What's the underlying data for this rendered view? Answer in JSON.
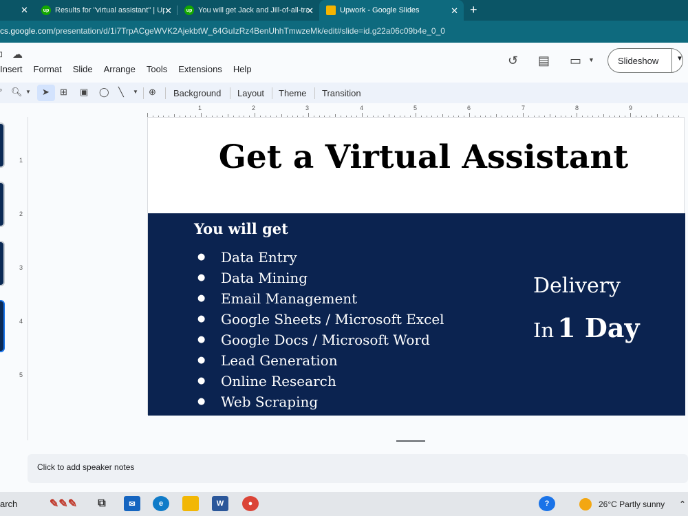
{
  "browser": {
    "tabs": [
      {
        "title": "Results for \"virtual assistant\" | Up",
        "favicon": "up"
      },
      {
        "title": "You will get Jack and Jill-of-all-tra",
        "favicon": "up"
      },
      {
        "title": "Upwork - Google Slides",
        "favicon": "slides",
        "active": true
      }
    ],
    "url_host": "cs.google.com",
    "url_path": "/presentation/d/1i7TrpACgeWVK2AjekbtW_64GuIzRz4BenUhhTmwzeMk/edit#slide=id.g22a06c09b4e_0_0"
  },
  "menu": [
    "Insert",
    "Format",
    "Slide",
    "Arrange",
    "Tools",
    "Extensions",
    "Help"
  ],
  "header": {
    "slideshow_label": "Slideshow"
  },
  "toolbar": {
    "background": "Background",
    "layout": "Layout",
    "theme": "Theme",
    "transition": "Transition"
  },
  "ruler_numbers": [
    "1",
    "2",
    "3",
    "4",
    "5",
    "6",
    "7",
    "8",
    "9"
  ],
  "vruler_numbers": [
    "1",
    "2",
    "3",
    "4",
    "5"
  ],
  "slide": {
    "title": "Get a Virtual Assistant",
    "heading": "You will get",
    "items": [
      "Data Entry",
      "Data Mining",
      "Email Management",
      "Google Sheets / Microsoft Excel",
      "Google Docs / Microsoft Word",
      "Lead Generation",
      "Online Research",
      "Web Scraping"
    ],
    "delivery_label": "Delivery",
    "delivery_prefix": "In",
    "delivery_value": "1 Day"
  },
  "notes": {
    "placeholder": "Click to add speaker notes"
  },
  "taskbar": {
    "search_label": "arch",
    "weather": "26°C  Partly sunny"
  },
  "colors": {
    "panel_bg": "#0b2350",
    "accent": "#1a73e8"
  }
}
